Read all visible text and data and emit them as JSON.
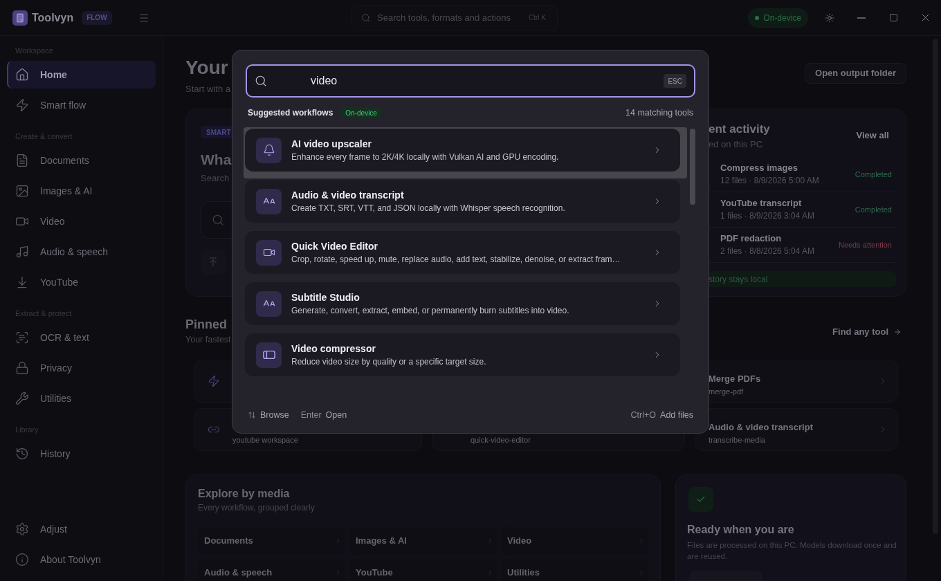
{
  "app": {
    "name": "Toolvyn",
    "badge": "FLOW"
  },
  "top_bar": {
    "search": {
      "placeholder": "Search tools, formats and actions",
      "shortcut": "Ctrl K"
    },
    "status": "On-device"
  },
  "sidebar": {
    "sections": [
      {
        "label": "Workspace",
        "items": [
          {
            "label": "Home",
            "selected": true
          },
          {
            "label": "Smart flow",
            "selected": false
          }
        ]
      },
      {
        "label": "Create & convert",
        "items": [
          {
            "label": "Documents",
            "selected": false
          },
          {
            "label": "Images & AI",
            "selected": false
          },
          {
            "label": "Video",
            "selected": false
          },
          {
            "label": "Audio & speech",
            "selected": false
          },
          {
            "label": "YouTube",
            "selected": false
          }
        ]
      },
      {
        "label": "Extract & protect",
        "items": [
          {
            "label": "OCR & text",
            "selected": false
          },
          {
            "label": "Privacy",
            "selected": false
          },
          {
            "label": "Utilities",
            "selected": false
          }
        ]
      },
      {
        "label": "Library",
        "items": [
          {
            "label": "History",
            "selected": false
          }
        ]
      }
    ],
    "footer_items": [
      {
        "label": "Adjust",
        "selected": false
      },
      {
        "label": "About Toolvyn",
        "selected": false
      }
    ]
  },
  "page": {
    "title": "Your",
    "subtitle": "Start with a",
    "button": "Open output folder"
  },
  "hero": {
    "badge": "SMART",
    "title": "Wha",
    "subtitle": "Search"
  },
  "recent_activity": {
    "title": "ent activity",
    "subtitle": "ed on this PC",
    "action": "View all",
    "rows": [
      {
        "name": "Compress images",
        "meta": "12 files · 8/9/2026 5:00 AM",
        "status": "Completed",
        "color": "#2f6a4d"
      },
      {
        "name": "YouTube transcript",
        "meta": "1 files · 8/9/2026 3:04 AM",
        "status": "Completed",
        "color": "#2f6a4d"
      },
      {
        "name": "PDF redaction",
        "meta": "2 files · 8/8/2026 5:04 AM",
        "status": "Needs attention",
        "color": "#7a3c48"
      }
    ],
    "note": "story stays local"
  },
  "pinned": {
    "title": "Pinned",
    "subtitle": "Your fastest",
    "action": "Find any tool",
    "items": [
      {
        "title": "Merge PDFs",
        "slug": "merge-pdf"
      },
      {
        "slug": "youtube workspace"
      },
      {
        "slug": "quick-video-editor"
      },
      {
        "title": "Audio & video transcript",
        "slug": "transcribe-media"
      }
    ]
  },
  "explore": {
    "title": "Explore by media",
    "subtitle": "Every workflow, grouped clearly",
    "items": [
      "Documents",
      "Images & AI",
      "Video",
      "Audio & speech",
      "YouTube",
      "Utilities"
    ]
  },
  "ready": {
    "title": "Ready when you are",
    "text": "Files are processed on this PC. Models download once and are reused."
  },
  "command_palette": {
    "query": "video",
    "shortcut": "ESC",
    "heading": "Suggested workflows",
    "badge": "On-device",
    "count": "14 matching tools",
    "results": [
      {
        "title": "AI video upscaler",
        "description": "Enhance every frame to 2K/4K locally with Vulkan AI and GPU encoding.",
        "selected": true
      },
      {
        "title": "Audio & video transcript",
        "description": "Create TXT, SRT, VTT, and JSON locally with Whisper speech recognition.",
        "selected": false
      },
      {
        "title": "Quick Video Editor",
        "description": "Crop, rotate, speed up, mute, replace audio, add text, stabilize, denoise, or extract fram…",
        "selected": false
      },
      {
        "title": "Subtitle Studio",
        "description": "Generate, convert, extract, embed, or permanently burn subtitles into video.",
        "selected": false
      },
      {
        "title": "Video compressor",
        "description": "Reduce video size by quality or a specific target size.",
        "selected": false
      }
    ],
    "hints": [
      {
        "label": "Browse"
      },
      {
        "key": "Enter",
        "label": "Open"
      },
      {
        "key": "Ctrl+O",
        "label": "Add files"
      }
    ]
  }
}
